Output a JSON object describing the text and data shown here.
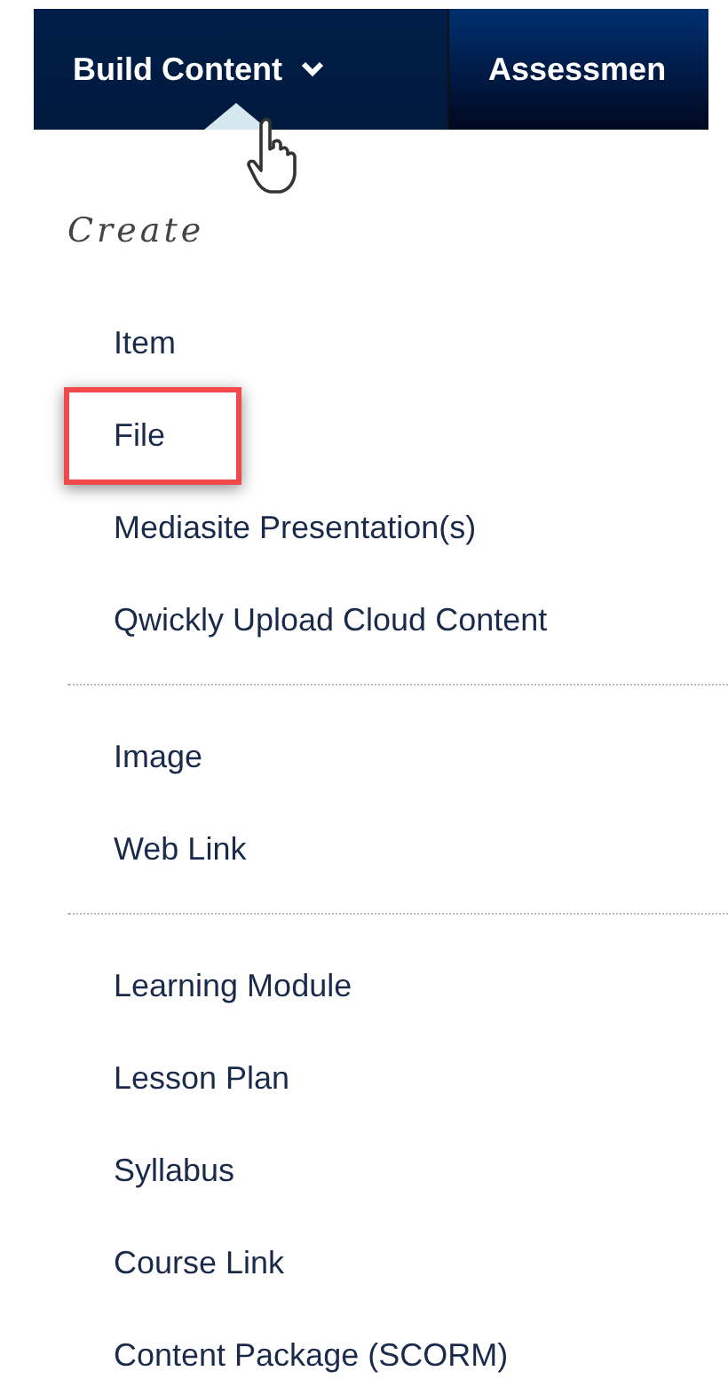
{
  "tabs": [
    {
      "label": "Build Content",
      "selected": true,
      "has_menu": true
    },
    {
      "label": "Assessmen",
      "selected": false,
      "has_menu": false
    }
  ],
  "menu": {
    "heading": "Create",
    "groups": [
      {
        "items": [
          {
            "label": "Item",
            "highlighted": false
          },
          {
            "label": "File",
            "highlighted": true
          },
          {
            "label": "Mediasite Presentation(s)",
            "highlighted": false
          },
          {
            "label": "Qwickly Upload Cloud Content",
            "highlighted": false
          }
        ]
      },
      {
        "items": [
          {
            "label": "Image",
            "highlighted": false
          },
          {
            "label": "Web Link",
            "highlighted": false
          }
        ]
      },
      {
        "items": [
          {
            "label": "Learning Module",
            "highlighted": false
          },
          {
            "label": "Lesson Plan",
            "highlighted": false
          },
          {
            "label": "Syllabus",
            "highlighted": false
          },
          {
            "label": "Course Link",
            "highlighted": false
          },
          {
            "label": "Content Package (SCORM)",
            "highlighted": false
          }
        ]
      }
    ]
  }
}
